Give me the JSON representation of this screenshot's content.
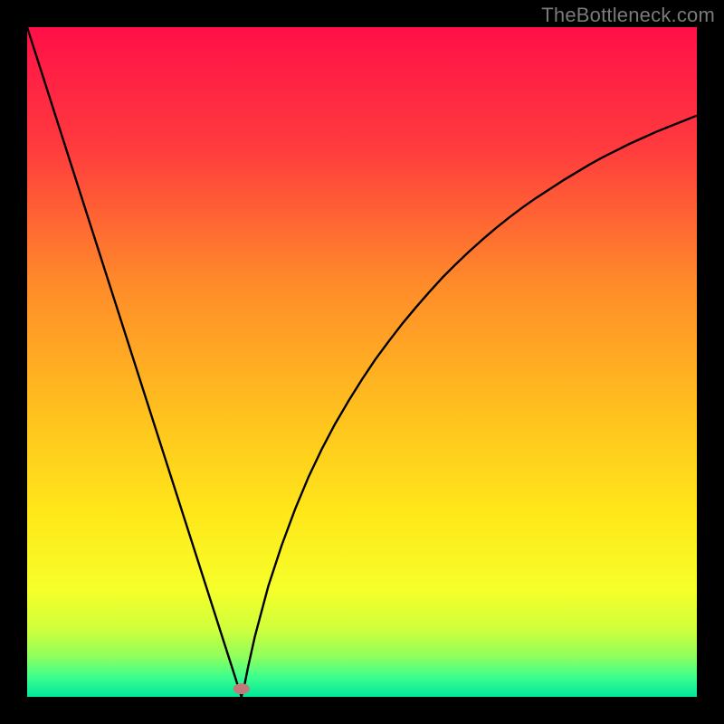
{
  "watermark": "TheBottleneck.com",
  "chart_data": {
    "type": "line",
    "title": "",
    "xlabel": "",
    "ylabel": "",
    "xlim": [
      0,
      100
    ],
    "ylim": [
      0,
      100
    ],
    "minimum_x": 32,
    "marker": {
      "x": 32,
      "y": 1.2,
      "color": "#c27a79"
    },
    "x": [
      0,
      2,
      4,
      6,
      8,
      10,
      12,
      14,
      16,
      18,
      20,
      22,
      24,
      26,
      28,
      30,
      31,
      31.5,
      32,
      32.5,
      33,
      34,
      36,
      38,
      40,
      42,
      44,
      46,
      48,
      50,
      52,
      54,
      56,
      58,
      60,
      62,
      64,
      66,
      68,
      70,
      72,
      74,
      76,
      78,
      80,
      82,
      84,
      86,
      88,
      90,
      92,
      94,
      96,
      98,
      100
    ],
    "values": [
      100,
      93.75,
      87.5,
      81.25,
      75,
      68.75,
      62.5,
      56.25,
      50,
      43.75,
      37.5,
      31.25,
      25,
      18.75,
      12.5,
      6.25,
      3.13,
      1.56,
      0,
      2.0,
      4.5,
      9.0,
      16.5,
      22.6,
      28.0,
      32.8,
      37.0,
      40.8,
      44.2,
      47.4,
      50.4,
      53.1,
      55.7,
      58.1,
      60.4,
      62.6,
      64.6,
      66.5,
      68.3,
      70.0,
      71.6,
      73.1,
      74.5,
      75.8,
      77.1,
      78.3,
      79.5,
      80.6,
      81.6,
      82.6,
      83.5,
      84.4,
      85.2,
      86.0,
      86.8
    ],
    "gradient_stops": [
      {
        "offset": 0,
        "color": "#ff1048"
      },
      {
        "offset": 18,
        "color": "#ff3b3e"
      },
      {
        "offset": 38,
        "color": "#ff8a2a"
      },
      {
        "offset": 58,
        "color": "#ffc21e"
      },
      {
        "offset": 73,
        "color": "#ffe81a"
      },
      {
        "offset": 84,
        "color": "#f6ff2a"
      },
      {
        "offset": 90,
        "color": "#ceff3c"
      },
      {
        "offset": 94,
        "color": "#8fff5d"
      },
      {
        "offset": 97,
        "color": "#3eff8d"
      },
      {
        "offset": 100,
        "color": "#00e69a"
      }
    ]
  }
}
